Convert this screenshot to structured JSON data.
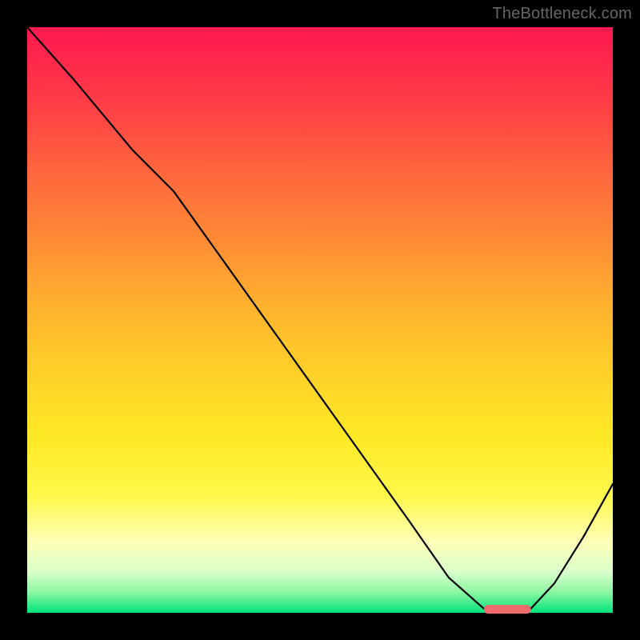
{
  "watermark": "TheBottleneck.com",
  "colors": {
    "frame_bg": "#000000",
    "curve": "#000000",
    "marker": "#ef6b6b",
    "gradient_stops": [
      {
        "pos": 0.0,
        "hex": "#ff1850"
      },
      {
        "pos": 0.12,
        "hex": "#ff3a47"
      },
      {
        "pos": 0.24,
        "hex": "#ff633e"
      },
      {
        "pos": 0.36,
        "hex": "#ff8a36"
      },
      {
        "pos": 0.48,
        "hex": "#ffb32e"
      },
      {
        "pos": 0.6,
        "hex": "#ffd328"
      },
      {
        "pos": 0.7,
        "hex": "#ffe926"
      },
      {
        "pos": 0.8,
        "hex": "#fff84a"
      },
      {
        "pos": 0.88,
        "hex": "#fdffb8"
      },
      {
        "pos": 0.93,
        "hex": "#d9ffca"
      },
      {
        "pos": 0.965,
        "hex": "#8cf7a3"
      },
      {
        "pos": 1.0,
        "hex": "#00e37a"
      }
    ]
  },
  "chart_data": {
    "type": "line",
    "title": "",
    "xlabel": "",
    "ylabel": "",
    "xlim": [
      0,
      100
    ],
    "ylim": [
      0,
      100
    ],
    "notes": "Single black curve over heat-gradient background. Y-axis value corresponds to bottleneck percentage (red≈100%, green≈0%). Curve drops from near 100% on the left to ~0% at x≈78–86, then rises again toward the right edge. A short rounded red marker sits on the flat minimum.",
    "series": [
      {
        "name": "curve",
        "x": [
          0,
          8,
          18,
          25,
          35,
          45,
          55,
          65,
          72,
          78,
          82,
          86,
          90,
          95,
          100
        ],
        "values": [
          100,
          91,
          79,
          72,
          58,
          44,
          30,
          16,
          6,
          0.7,
          0.6,
          0.7,
          5,
          13,
          22
        ]
      }
    ],
    "annotations": [
      {
        "type": "marker",
        "shape": "rounded-bar",
        "x_range": [
          78,
          86
        ],
        "y": 0.6,
        "color": "#ef6b6b"
      }
    ]
  }
}
